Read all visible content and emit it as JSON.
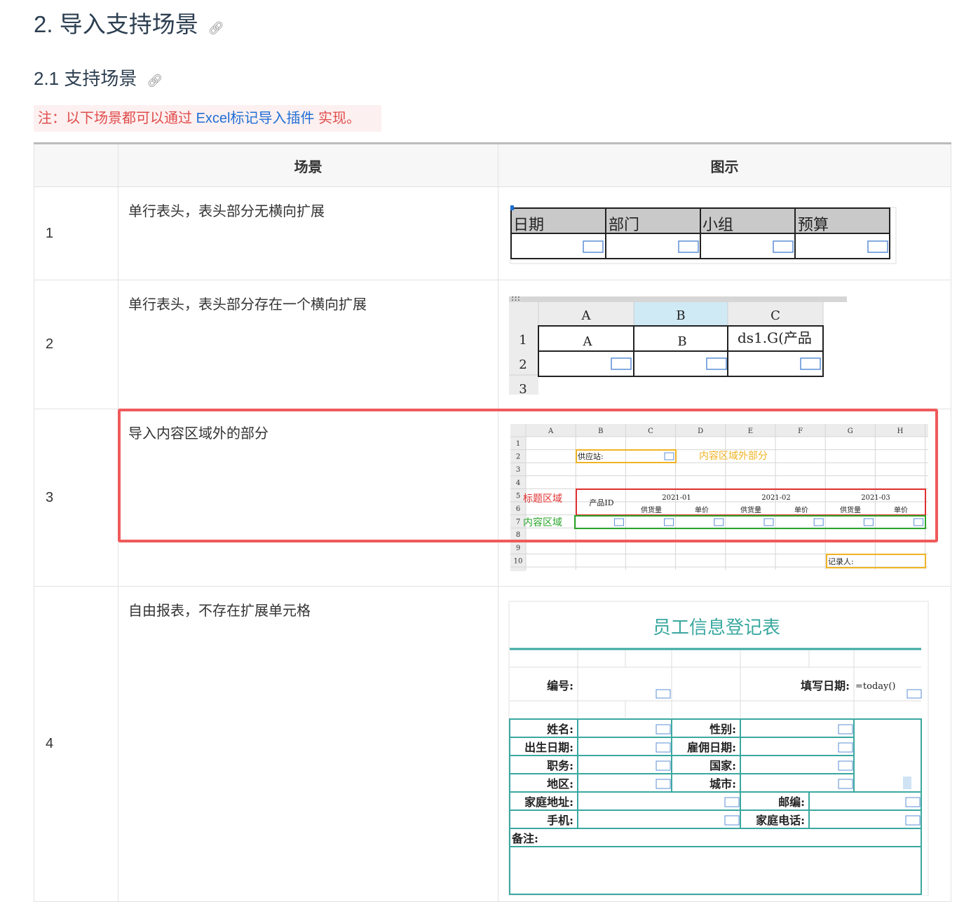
{
  "heading": {
    "title": "2. 导入支持场景",
    "subtitle": "2.1 支持场景"
  },
  "note": {
    "prefix": "注：以下场景都可以通过 ",
    "link": "Excel标记导入插件",
    "suffix": " 实现。"
  },
  "table": {
    "headers": [
      "",
      "场景",
      "图示"
    ],
    "rows": [
      {
        "num": "1",
        "desc": "单行表头，表头部分无横向扩展"
      },
      {
        "num": "2",
        "desc": "单行表头，表头部分存在一个横向扩展"
      },
      {
        "num": "3",
        "desc": "导入内容区域外的部分"
      },
      {
        "num": "4",
        "desc": "自由报表，不存在扩展单元格"
      }
    ]
  },
  "fig1": {
    "headers": [
      "日期",
      "部门",
      "小组",
      "预算"
    ]
  },
  "fig2": {
    "cols": [
      "A",
      "B",
      "C"
    ],
    "rows": [
      "1",
      "2",
      "3"
    ],
    "cells": [
      "A",
      "B",
      "ds1.G(产品"
    ]
  },
  "fig3": {
    "cols": [
      "A",
      "B",
      "C",
      "D",
      "E",
      "F",
      "G",
      "H"
    ],
    "rows": [
      "1",
      "2",
      "3",
      "4",
      "5",
      "6",
      "7",
      "8",
      "9",
      "10"
    ],
    "supplier": "供应站:",
    "outside_label": "内容区域外部分",
    "title_label": "标题区域",
    "content_label": "内容区域",
    "product_id": "产品ID",
    "months": [
      "2021-01",
      "2021-02",
      "2021-03"
    ],
    "sub": [
      "供货量",
      "单价"
    ],
    "recorder": "记录人:"
  },
  "fig4": {
    "title": "员工信息登记表",
    "number": "编号:",
    "fill_date": "填写日期:",
    "today": "=today()",
    "left_labels": [
      "姓名:",
      "出生日期:",
      "职务:",
      "地区:"
    ],
    "mid_labels": [
      "性别:",
      "雇佣日期:",
      "国家:",
      "城市:"
    ],
    "address": "家庭地址:",
    "zip": "邮编:",
    "mobile": "手机:",
    "home_phone": "家庭电话:",
    "remark": "备注:"
  }
}
